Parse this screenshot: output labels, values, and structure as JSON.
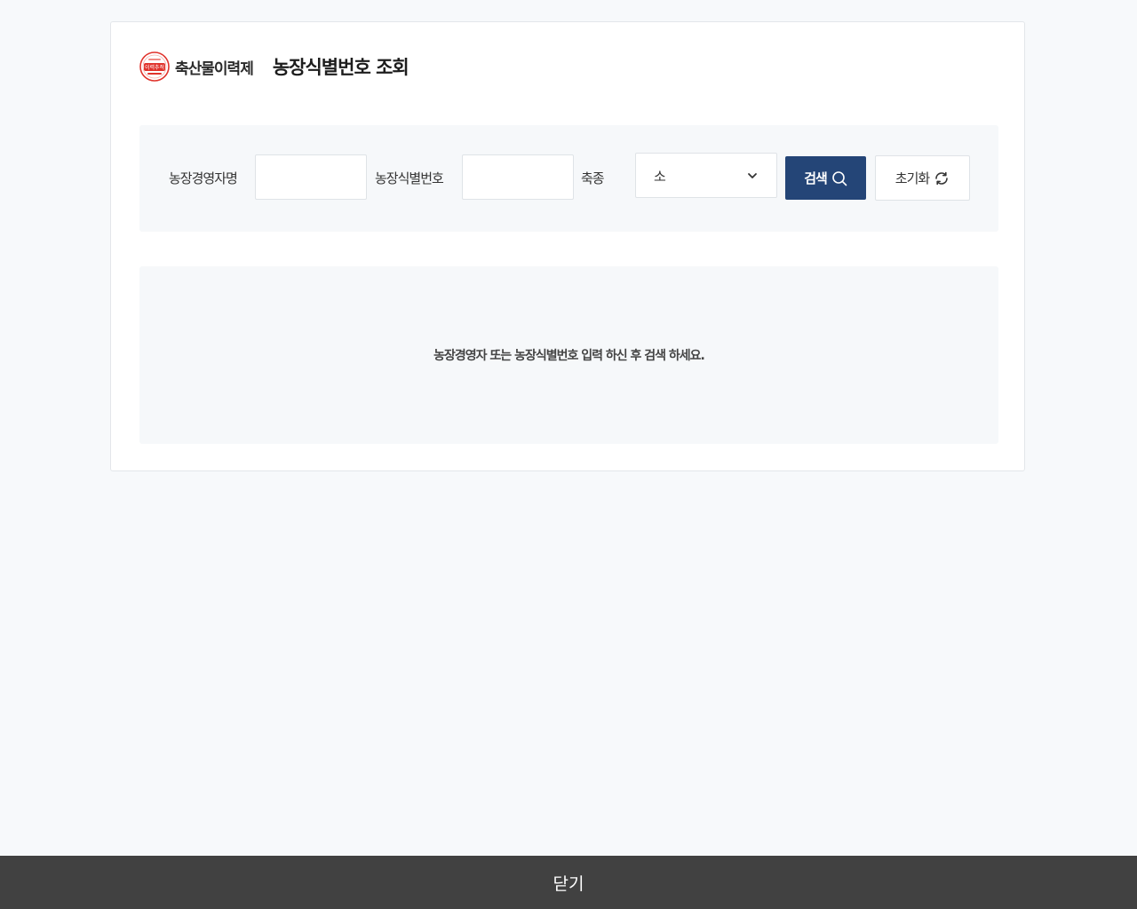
{
  "header": {
    "logo_text": "축산물이력제",
    "logo_badge_text": "이력추적",
    "title": "농장식별번호 조회"
  },
  "search": {
    "owner_label": "농장경영자명",
    "owner_value": "",
    "farm_id_label": "농장식별번호",
    "farm_id_value": "",
    "species_label": "축종",
    "species_selected": "소",
    "search_button": "검색",
    "reset_button": "초기화"
  },
  "result": {
    "message": "농장경영자 또는 농장식별번호 입력 하신 후 검색 하세요."
  },
  "footer": {
    "close_label": "닫기"
  },
  "colors": {
    "primary_button": "#244577",
    "footer_bar": "#414141",
    "logo_red": "#e0332c"
  },
  "icons": {
    "search": "search-icon",
    "reset": "refresh-icon",
    "dropdown": "chevron-down-icon"
  }
}
